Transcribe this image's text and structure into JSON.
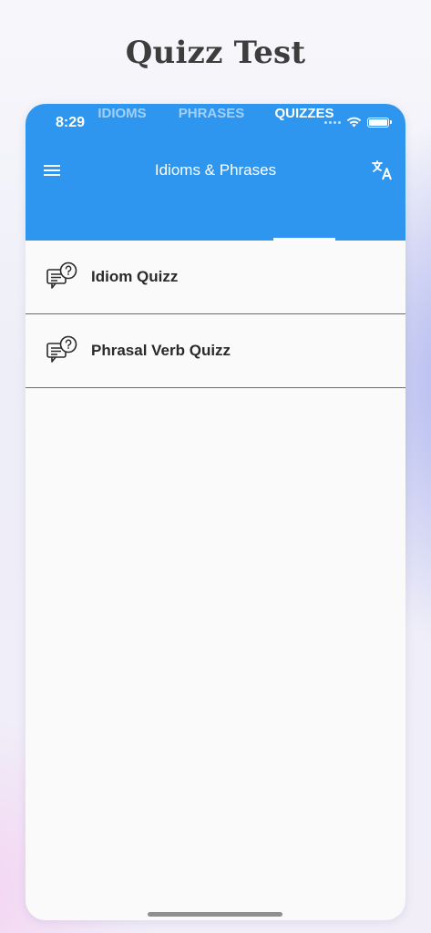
{
  "marketing": {
    "title": "Quizz Test"
  },
  "status_bar": {
    "time": "8:29"
  },
  "header": {
    "title": "Idioms & Phrases",
    "menu_icon": "hamburger-menu-icon",
    "translate_icon": "translate-icon"
  },
  "tabs": [
    {
      "label": "IDIOMS",
      "active": false
    },
    {
      "label": "PHRASES",
      "active": false
    },
    {
      "label": "QUIZZES",
      "active": true
    }
  ],
  "quizzes": [
    {
      "label": "Idiom Quizz",
      "icon": "quiz-chat-question-icon"
    },
    {
      "label": "Phrasal Verb Quizz",
      "icon": "quiz-chat-question-icon"
    }
  ],
  "colors": {
    "primary": "#2e96ee",
    "background": "#fafafa",
    "text": "#2a2a2a"
  }
}
